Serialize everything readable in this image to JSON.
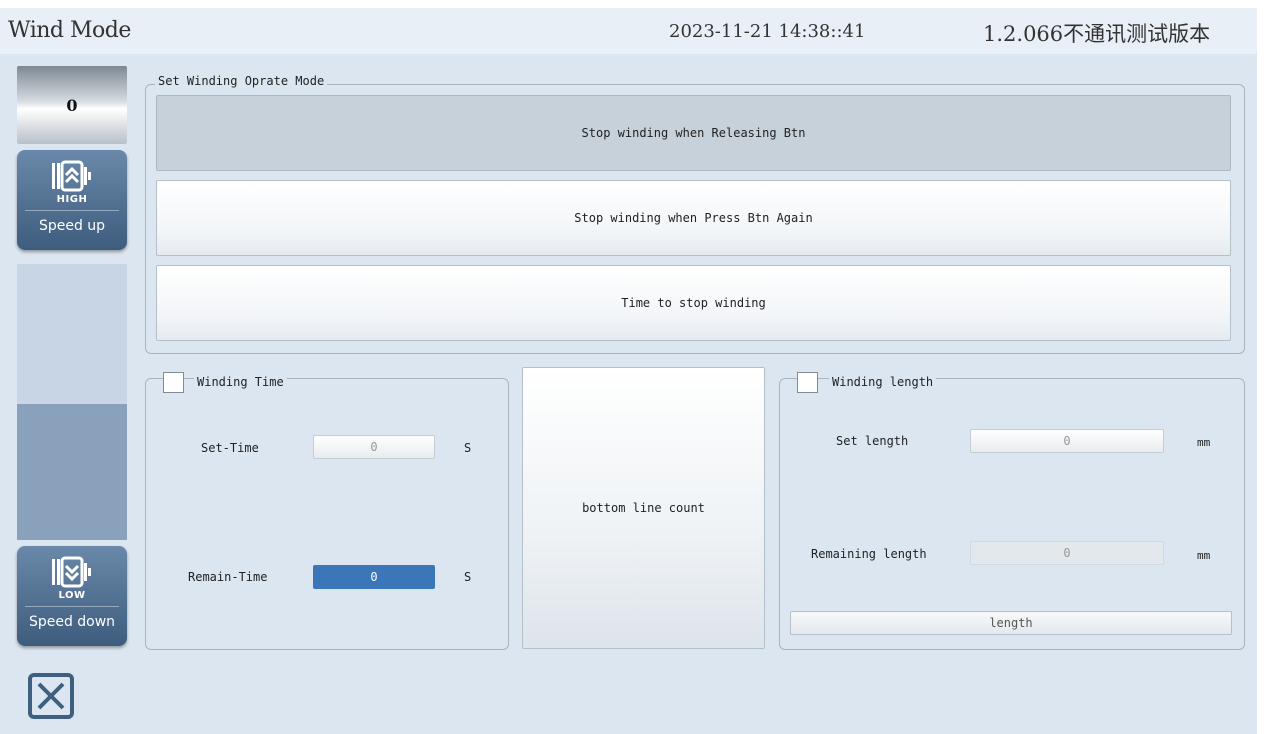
{
  "header": {
    "title": "Wind Mode",
    "datetime": "2023-11-21 14:38::41",
    "version": "1.2.066不通讯测试版本"
  },
  "sidebar": {
    "counter": "0",
    "speed_up": {
      "tag": "HIGH",
      "label": "Speed up",
      "icon": "motor-up-icon"
    },
    "speed_down": {
      "tag": "LOW",
      "label": "Speed down",
      "icon": "motor-down-icon"
    },
    "close_icon": "close-icon"
  },
  "mode_group": {
    "title": "Set Winding Oprate Mode",
    "options": [
      {
        "label": "Stop winding when Releasing Btn",
        "selected": true
      },
      {
        "label": "Stop winding when Press Btn Again",
        "selected": false
      },
      {
        "label": "Time to stop winding",
        "selected": false
      }
    ]
  },
  "time_group": {
    "title": "Winding Time",
    "checked": false,
    "set_label": "Set-Time",
    "set_value": "0",
    "set_unit": "S",
    "remain_label": "Remain-Time",
    "remain_value": "0",
    "remain_unit": "S"
  },
  "bottom_line": {
    "label": "bottom line count"
  },
  "length_group": {
    "title": "Winding length",
    "checked": false,
    "set_label": "Set length",
    "set_value": "0",
    "set_unit": "mm",
    "remain_label": "Remaining length",
    "remain_value": "0",
    "remain_unit": "mm",
    "button_label": "length"
  },
  "colors": {
    "background": "#dbe6f0",
    "side_button": "#4f6d8e",
    "active_field": "#3b77b8"
  }
}
